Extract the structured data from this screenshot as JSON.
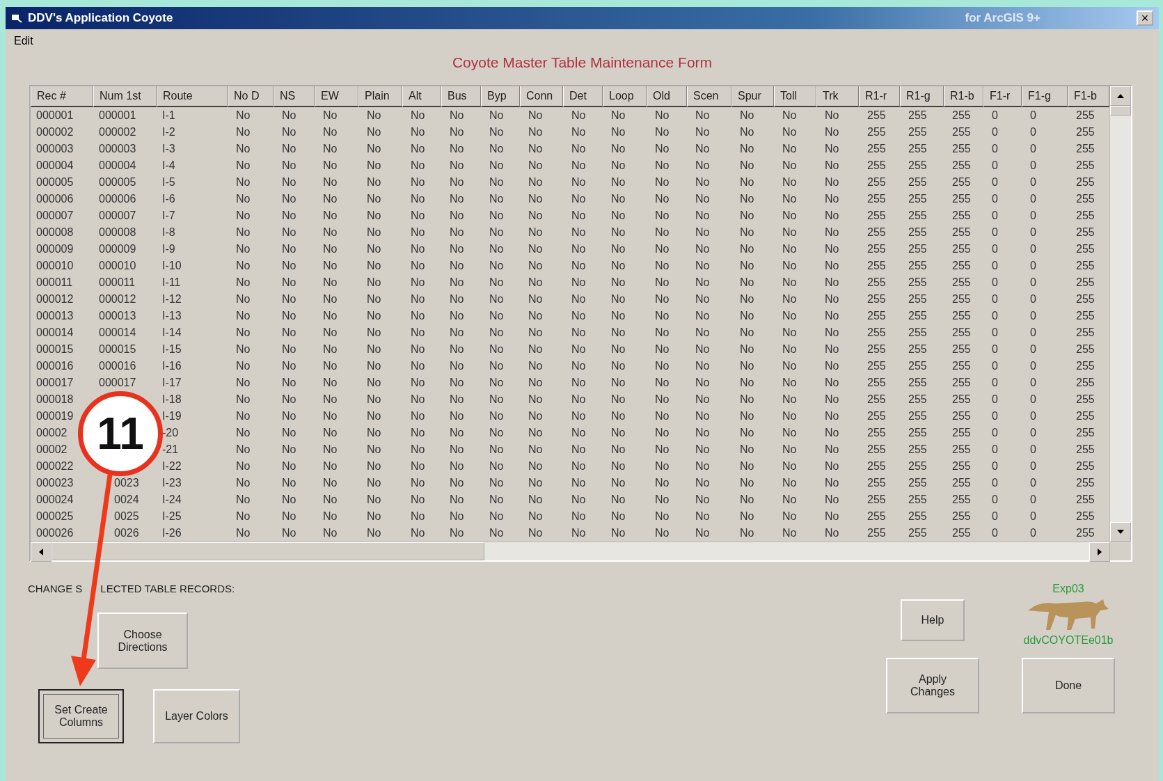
{
  "window": {
    "title": "DDV's Application Coyote",
    "subtitle": "for ArcGIS 9+",
    "close": "×"
  },
  "menu": [
    "Edit"
  ],
  "form_title": "Coyote Master Table Maintenance Form",
  "table": {
    "columns": [
      "Rec #",
      "Num 1st",
      "Route",
      "No D",
      "NS",
      "EW",
      "Plain",
      "Alt",
      "Bus",
      "Byp",
      "Conn",
      "Det",
      "Loop",
      "Old",
      "Scen",
      "Spur",
      "Toll",
      "Trk",
      "R1-r",
      "R1-g",
      "R1-b",
      "F1-r",
      "F1-g",
      "F1-b"
    ],
    "rows": [
      [
        "000001",
        "000001",
        "I-1",
        "No",
        "No",
        "No",
        "No",
        "No",
        "No",
        "No",
        "No",
        "No",
        "No",
        "No",
        "No",
        "No",
        "No",
        "No",
        "255",
        "255",
        "255",
        "0",
        "0",
        "255"
      ],
      [
        "000002",
        "000002",
        "I-2",
        "No",
        "No",
        "No",
        "No",
        "No",
        "No",
        "No",
        "No",
        "No",
        "No",
        "No",
        "No",
        "No",
        "No",
        "No",
        "255",
        "255",
        "255",
        "0",
        "0",
        "255"
      ],
      [
        "000003",
        "000003",
        "I-3",
        "No",
        "No",
        "No",
        "No",
        "No",
        "No",
        "No",
        "No",
        "No",
        "No",
        "No",
        "No",
        "No",
        "No",
        "No",
        "255",
        "255",
        "255",
        "0",
        "0",
        "255"
      ],
      [
        "000004",
        "000004",
        "I-4",
        "No",
        "No",
        "No",
        "No",
        "No",
        "No",
        "No",
        "No",
        "No",
        "No",
        "No",
        "No",
        "No",
        "No",
        "No",
        "255",
        "255",
        "255",
        "0",
        "0",
        "255"
      ],
      [
        "000005",
        "000005",
        "I-5",
        "No",
        "No",
        "No",
        "No",
        "No",
        "No",
        "No",
        "No",
        "No",
        "No",
        "No",
        "No",
        "No",
        "No",
        "No",
        "255",
        "255",
        "255",
        "0",
        "0",
        "255"
      ],
      [
        "000006",
        "000006",
        "I-6",
        "No",
        "No",
        "No",
        "No",
        "No",
        "No",
        "No",
        "No",
        "No",
        "No",
        "No",
        "No",
        "No",
        "No",
        "No",
        "255",
        "255",
        "255",
        "0",
        "0",
        "255"
      ],
      [
        "000007",
        "000007",
        "I-7",
        "No",
        "No",
        "No",
        "No",
        "No",
        "No",
        "No",
        "No",
        "No",
        "No",
        "No",
        "No",
        "No",
        "No",
        "No",
        "255",
        "255",
        "255",
        "0",
        "0",
        "255"
      ],
      [
        "000008",
        "000008",
        "I-8",
        "No",
        "No",
        "No",
        "No",
        "No",
        "No",
        "No",
        "No",
        "No",
        "No",
        "No",
        "No",
        "No",
        "No",
        "No",
        "255",
        "255",
        "255",
        "0",
        "0",
        "255"
      ],
      [
        "000009",
        "000009",
        "I-9",
        "No",
        "No",
        "No",
        "No",
        "No",
        "No",
        "No",
        "No",
        "No",
        "No",
        "No",
        "No",
        "No",
        "No",
        "No",
        "255",
        "255",
        "255",
        "0",
        "0",
        "255"
      ],
      [
        "000010",
        "000010",
        "I-10",
        "No",
        "No",
        "No",
        "No",
        "No",
        "No",
        "No",
        "No",
        "No",
        "No",
        "No",
        "No",
        "No",
        "No",
        "No",
        "255",
        "255",
        "255",
        "0",
        "0",
        "255"
      ],
      [
        "000011",
        "000011",
        "I-11",
        "No",
        "No",
        "No",
        "No",
        "No",
        "No",
        "No",
        "No",
        "No",
        "No",
        "No",
        "No",
        "No",
        "No",
        "No",
        "255",
        "255",
        "255",
        "0",
        "0",
        "255"
      ],
      [
        "000012",
        "000012",
        "I-12",
        "No",
        "No",
        "No",
        "No",
        "No",
        "No",
        "No",
        "No",
        "No",
        "No",
        "No",
        "No",
        "No",
        "No",
        "No",
        "255",
        "255",
        "255",
        "0",
        "0",
        "255"
      ],
      [
        "000013",
        "000013",
        "I-13",
        "No",
        "No",
        "No",
        "No",
        "No",
        "No",
        "No",
        "No",
        "No",
        "No",
        "No",
        "No",
        "No",
        "No",
        "No",
        "255",
        "255",
        "255",
        "0",
        "0",
        "255"
      ],
      [
        "000014",
        "000014",
        "I-14",
        "No",
        "No",
        "No",
        "No",
        "No",
        "No",
        "No",
        "No",
        "No",
        "No",
        "No",
        "No",
        "No",
        "No",
        "No",
        "255",
        "255",
        "255",
        "0",
        "0",
        "255"
      ],
      [
        "000015",
        "000015",
        "I-15",
        "No",
        "No",
        "No",
        "No",
        "No",
        "No",
        "No",
        "No",
        "No",
        "No",
        "No",
        "No",
        "No",
        "No",
        "No",
        "255",
        "255",
        "255",
        "0",
        "0",
        "255"
      ],
      [
        "000016",
        "000016",
        "I-16",
        "No",
        "No",
        "No",
        "No",
        "No",
        "No",
        "No",
        "No",
        "No",
        "No",
        "No",
        "No",
        "No",
        "No",
        "No",
        "255",
        "255",
        "255",
        "0",
        "0",
        "255"
      ],
      [
        "000017",
        "000017",
        "I-17",
        "No",
        "No",
        "No",
        "No",
        "No",
        "No",
        "No",
        "No",
        "No",
        "No",
        "No",
        "No",
        "No",
        "No",
        "No",
        "255",
        "255",
        "255",
        "0",
        "0",
        "255"
      ],
      [
        "000018",
        null,
        "I-18",
        "No",
        "No",
        "No",
        "No",
        "No",
        "No",
        "No",
        "No",
        "No",
        "No",
        "No",
        "No",
        "No",
        "No",
        "No",
        "255",
        "255",
        "255",
        "0",
        "0",
        "255"
      ],
      [
        "000019",
        null,
        "I-19",
        "No",
        "No",
        "No",
        "No",
        "No",
        "No",
        "No",
        "No",
        "No",
        "No",
        "No",
        "No",
        "No",
        "No",
        "No",
        "255",
        "255",
        "255",
        "0",
        "0",
        "255"
      ],
      [
        "00002",
        null,
        "-20",
        "No",
        "No",
        "No",
        "No",
        "No",
        "No",
        "No",
        "No",
        "No",
        "No",
        "No",
        "No",
        "No",
        "No",
        "No",
        "255",
        "255",
        "255",
        "0",
        "0",
        "255"
      ],
      [
        "00002",
        null,
        "-21",
        "No",
        "No",
        "No",
        "No",
        "No",
        "No",
        "No",
        "No",
        "No",
        "No",
        "No",
        "No",
        "No",
        "No",
        "No",
        "255",
        "255",
        "255",
        "0",
        "0",
        "255"
      ],
      [
        "000022",
        null,
        "I-22",
        "No",
        "No",
        "No",
        "No",
        "No",
        "No",
        "No",
        "No",
        "No",
        "No",
        "No",
        "No",
        "No",
        "No",
        "No",
        "255",
        "255",
        "255",
        "0",
        "0",
        "255"
      ],
      [
        "000023",
        "0023",
        "I-23",
        "No",
        "No",
        "No",
        "No",
        "No",
        "No",
        "No",
        "No",
        "No",
        "No",
        "No",
        "No",
        "No",
        "No",
        "No",
        "255",
        "255",
        "255",
        "0",
        "0",
        "255"
      ],
      [
        "000024",
        "0024",
        "I-24",
        "No",
        "No",
        "No",
        "No",
        "No",
        "No",
        "No",
        "No",
        "No",
        "No",
        "No",
        "No",
        "No",
        "No",
        "No",
        "255",
        "255",
        "255",
        "0",
        "0",
        "255"
      ],
      [
        "000025",
        "0025",
        "I-25",
        "No",
        "No",
        "No",
        "No",
        "No",
        "No",
        "No",
        "No",
        "No",
        "No",
        "No",
        "No",
        "No",
        "No",
        "No",
        "255",
        "255",
        "255",
        "0",
        "0",
        "255"
      ],
      [
        "000026",
        "0026",
        "I-26",
        "No",
        "No",
        "No",
        "No",
        "No",
        "No",
        "No",
        "No",
        "No",
        "No",
        "No",
        "No",
        "No",
        "No",
        "No",
        "255",
        "255",
        "255",
        "0",
        "0",
        "255"
      ]
    ]
  },
  "section_label": [
    "CHANGE S",
    "LECTED TABLE RECORDS:"
  ],
  "buttons": [
    {
      "label": "Choose Directions",
      "focused": false
    },
    {
      "label": "Set Create Columns",
      "focused": true
    },
    {
      "label": "Layer Colors",
      "focused": false
    },
    {
      "label": "Help",
      "focused": false
    },
    {
      "label": "Apply Changes",
      "focused": false
    },
    {
      "label": "Done",
      "focused": false
    }
  ],
  "version": "Exp03",
  "build": "ddvCOYOTEe01b",
  "annotation": {
    "number": "11"
  }
}
